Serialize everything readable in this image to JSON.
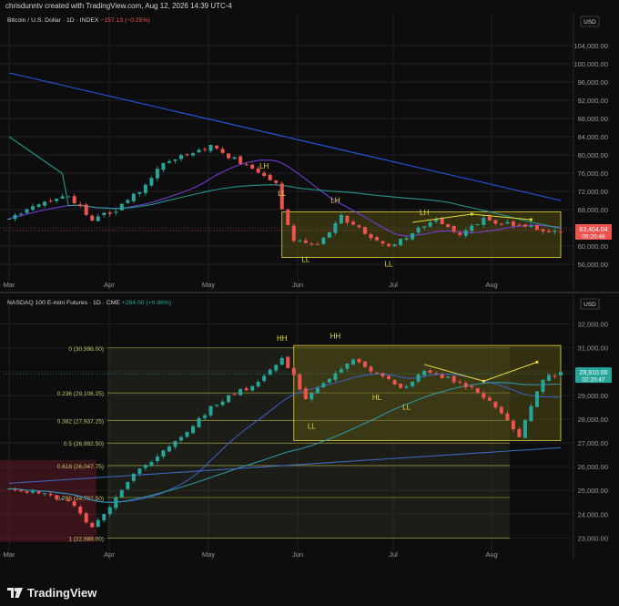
{
  "header": {
    "created_text": "chrisdunntv created with TradingView.com, Aug 12, 2026 14:39 UTC-4"
  },
  "footer": {
    "brand": "TradingView"
  },
  "colors": {
    "bg": "#0d0d0d",
    "up": "#26a69a",
    "down": "#ef5350",
    "ma_blue": "#2962ff",
    "ma_teal": "#26a69a",
    "ma_purple": "#7b3fe4",
    "box_yellow": "#e6d93a",
    "text": "#d1d4dc",
    "axis_text": "#9598a1"
  },
  "chart_data": [
    {
      "type": "candlestick",
      "symbol": "Bitcoin / U.S. Dollar · 1D · INDEX",
      "change": "−157.13 (−0.25%)",
      "currency": "USD",
      "x_ticks": [
        "Mar",
        "Apr",
        "May",
        "Jun",
        "Jul",
        "Aug"
      ],
      "y_ticks": [
        "104,000.00",
        "100,000.00",
        "96,000.00",
        "92,000.00",
        "88,000.00",
        "84,000.00",
        "80,000.00",
        "76,000.00",
        "72,000.00",
        "68,000.00",
        "64,000.00",
        "60,000.00",
        "56,000.00"
      ],
      "ylim": [
        52000,
        108000
      ],
      "last_price": "63,404.04",
      "countdown": "09:20:48",
      "annotations": [
        "LH",
        "LL",
        "LL",
        "LL",
        "LH",
        "LH"
      ],
      "close_anchors": [
        [
          0,
          66500
        ],
        [
          5,
          69000
        ],
        [
          10,
          71000
        ],
        [
          14,
          66000
        ],
        [
          18,
          68000
        ],
        [
          22,
          72000
        ],
        [
          26,
          78000
        ],
        [
          30,
          80000
        ],
        [
          34,
          82000
        ],
        [
          38,
          79000
        ],
        [
          42,
          76000
        ],
        [
          45,
          73500
        ],
        [
          46,
          68000
        ],
        [
          48,
          61000
        ],
        [
          52,
          60500
        ],
        [
          56,
          66500
        ],
        [
          60,
          63000
        ],
        [
          64,
          59500
        ],
        [
          68,
          63000
        ],
        [
          72,
          65500
        ],
        [
          76,
          62800
        ],
        [
          80,
          65800
        ],
        [
          84,
          65000
        ],
        [
          88,
          64000
        ],
        [
          92,
          63400
        ]
      ],
      "box": {
        "i0": 46,
        "i1": 93,
        "top": 67500,
        "bottom": 57500
      }
    },
    {
      "type": "candlestick",
      "symbol": "NASDAQ 100 E-mini Futures · 1D · CME",
      "change": "+284.00 (+0.96%)",
      "currency": "USD",
      "x_ticks": [
        "Mar",
        "Apr",
        "May",
        "Jun",
        "Jul",
        "Aug"
      ],
      "y_ticks": [
        "32,000.00",
        "31,000.00",
        "30,000.00",
        "29,000.00",
        "28,000.00",
        "27,000.00",
        "26,000.00",
        "25,000.00",
        "24,000.00",
        "23,000.00"
      ],
      "ylim": [
        22400,
        32600
      ],
      "last_price": "29,910.00",
      "countdown": "02:20:47",
      "annotations": [
        "HH",
        "HH",
        "LL",
        "HL",
        "LL"
      ],
      "fib_levels": [
        {
          "ratio": "0",
          "price": 30996,
          "label": "0 (30,996.00)"
        },
        {
          "ratio": "0.236",
          "price": 29106.25,
          "label": "0.236 (29,106.25)"
        },
        {
          "ratio": "0.382",
          "price": 27937.25,
          "label": "0.382 (27,937.25)"
        },
        {
          "ratio": "0.5",
          "price": 26992.5,
          "label": "0.5 (26,992.50)"
        },
        {
          "ratio": "0.618",
          "price": 26047.75,
          "label": "0.618 (26,047.75)"
        },
        {
          "ratio": "0.786",
          "price": 24702.5,
          "label": "0.786 (24,702.50)"
        },
        {
          "ratio": "1",
          "price": 22989,
          "label": "1 (22,989.00)"
        }
      ],
      "close_anchors": [
        [
          0,
          25000
        ],
        [
          5,
          24900
        ],
        [
          10,
          24600
        ],
        [
          14,
          23400
        ],
        [
          16,
          24000
        ],
        [
          20,
          25400
        ],
        [
          25,
          26500
        ],
        [
          30,
          27500
        ],
        [
          35,
          28700
        ],
        [
          40,
          29300
        ],
        [
          44,
          30000
        ],
        [
          46,
          30600
        ],
        [
          48,
          29800
        ],
        [
          50,
          28800
        ],
        [
          54,
          29700
        ],
        [
          58,
          30500
        ],
        [
          62,
          29900
        ],
        [
          66,
          29300
        ],
        [
          70,
          30000
        ],
        [
          74,
          29700
        ],
        [
          78,
          29300
        ],
        [
          82,
          28500
        ],
        [
          86,
          27300
        ],
        [
          88,
          28600
        ],
        [
          90,
          29700
        ],
        [
          93,
          29910
        ]
      ],
      "box": {
        "i0": 48,
        "i1": 93,
        "top": 31100,
        "bottom": 27100
      }
    }
  ]
}
